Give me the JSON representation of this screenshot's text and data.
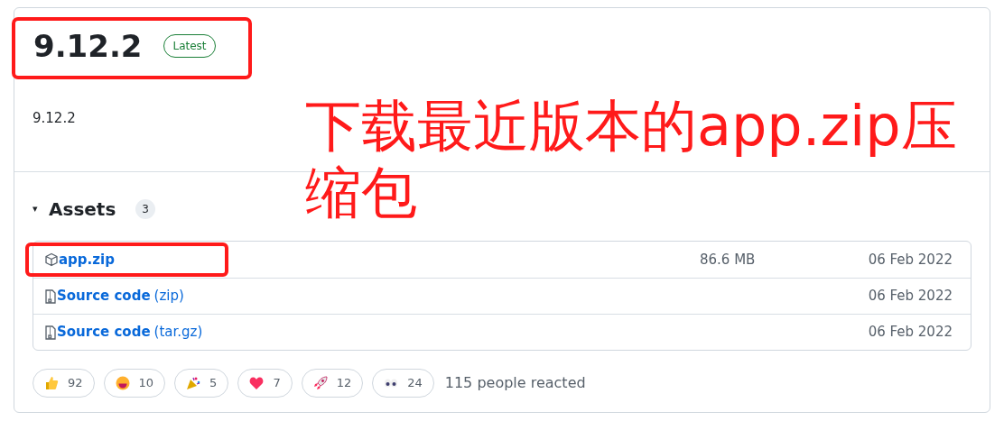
{
  "release": {
    "title": "9.12.2",
    "badge": "Latest",
    "title_highlighted": true,
    "description": "9.12.2"
  },
  "assets": {
    "toggle": "▾",
    "heading": "Assets",
    "count": "3",
    "items": [
      {
        "kind": "package",
        "name": "app.zip",
        "size": "86.6 MB",
        "date": "06 Feb 2022",
        "highlighted": true
      },
      {
        "kind": "source",
        "name": "Source code",
        "suffix": "(zip)",
        "date": "06 Feb 2022",
        "highlighted": false
      },
      {
        "kind": "source",
        "name": "Source code",
        "suffix": "(tar.gz)",
        "date": "06 Feb 2022",
        "highlighted": false
      }
    ]
  },
  "reactions": {
    "items": [
      {
        "kind": "thumbs-up",
        "count": "92"
      },
      {
        "kind": "smile",
        "count": "10"
      },
      {
        "kind": "party",
        "count": "5"
      },
      {
        "kind": "heart",
        "count": "7"
      },
      {
        "kind": "rocket",
        "count": "12"
      },
      {
        "kind": "eyes",
        "count": "24"
      }
    ],
    "summary": "115 people reacted"
  },
  "annotation": {
    "text": "下载最近版本的app.zip压缩包"
  }
}
